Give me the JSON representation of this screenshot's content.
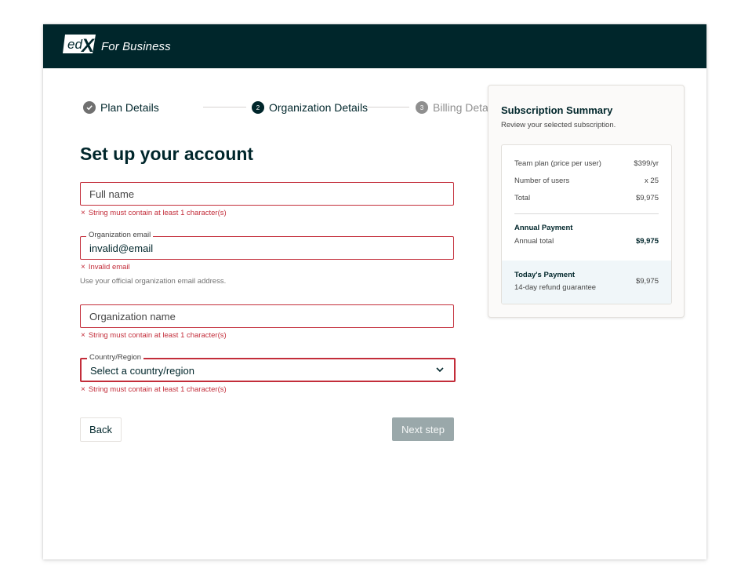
{
  "header": {
    "brand": "For Business",
    "logo_text": "edX"
  },
  "stepper": {
    "steps": [
      {
        "number": "",
        "label": "Plan Details",
        "state": "complete"
      },
      {
        "number": "2",
        "label": "Organization Details",
        "state": "current"
      },
      {
        "number": "3",
        "label": "Billing Details",
        "state": "upcoming"
      }
    ]
  },
  "form": {
    "title": "Set up your account",
    "full_name": {
      "placeholder": "Full name",
      "error": "String must contain at least 1 character(s)"
    },
    "org_email": {
      "label": "Organization email",
      "value": "invalid@email",
      "error": "Invalid email",
      "help": "Use your official organization email address."
    },
    "org_name": {
      "placeholder": "Organization name",
      "error": "String must contain at least 1 character(s)"
    },
    "country": {
      "label": "Country/Region",
      "value": "Select a country/region",
      "error": "String must contain at least 1 character(s)"
    },
    "back_label": "Back",
    "next_label": "Next step",
    "error_icon": "×"
  },
  "summary": {
    "title": "Subscription Summary",
    "subtitle": "Review your selected subscription.",
    "rows": [
      {
        "label": "Team plan (price per user)",
        "value": "$399/yr"
      },
      {
        "label": "Number of users",
        "value": "x 25"
      },
      {
        "label": "Total",
        "value": "$9,975"
      }
    ],
    "annual_heading": "Annual Payment",
    "annual_total_label": "Annual total",
    "annual_total_value": "$9,975",
    "today_heading": "Today's Payment",
    "today_sub": "14-day refund guarantee",
    "today_value": "$9,975"
  },
  "colors": {
    "header_bg": "#00262b",
    "error": "#c32d3a",
    "disabled_button": "#9aa8aa",
    "summary_highlight": "#f0f6f9"
  }
}
